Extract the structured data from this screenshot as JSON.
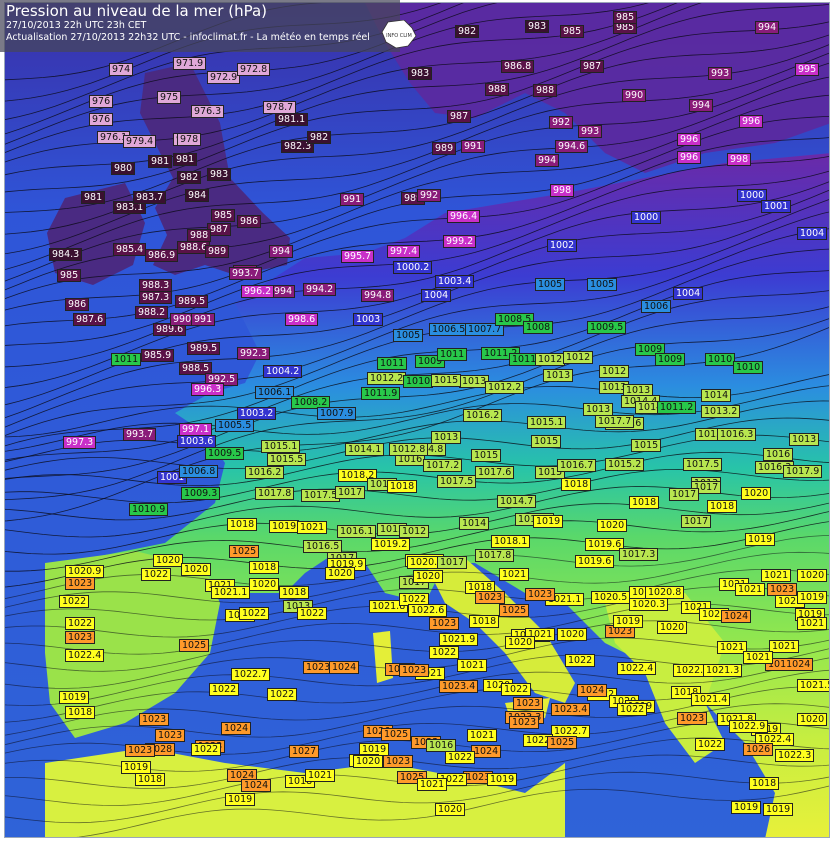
{
  "header": {
    "title": "Pression au niveau de la mer (hPa)",
    "line1": "27/10/2013  22h UTC  23h CET",
    "line2": "Actualisation 27/10/2013 22h32 UTC - infoclimat.fr - La météo en temps réel"
  },
  "logo_text": "INFO CLIM",
  "colors": {
    "water": "#2f63d8",
    "isobar": "#0a0a14",
    "p980": "#3a1030",
    "p985": "#5a1248",
    "p990": "#8a1c7a",
    "p995": "#c92fc9",
    "p1000": "#3434d0",
    "p1005": "#2a8ee0",
    "p1010": "#28c84a",
    "p1015": "#b8e650",
    "p1020": "#ffff1e",
    "p1025": "#ff9a2a",
    "low_pale": "#e0a8d8"
  },
  "stations": [
    {
      "t": "994",
      "v": 994
    },
    {
      "t": "995",
      "v": 995
    },
    {
      "t": "993",
      "v": 993
    },
    {
      "t": "990",
      "v": 990
    },
    {
      "t": "994",
      "v": 994
    },
    {
      "t": "996",
      "v": 996
    },
    {
      "t": "996",
      "v": 996
    },
    {
      "t": "996",
      "v": 996
    },
    {
      "t": "998",
      "v": 998
    },
    {
      "t": "1000",
      "v": 1000
    },
    {
      "t": "1001",
      "v": 1001
    },
    {
      "t": "1004",
      "v": 1004
    },
    {
      "t": "983",
      "v": 983
    },
    {
      "t": "985",
      "v": 985
    },
    {
      "t": "985",
      "v": 985
    },
    {
      "t": "982",
      "v": 982
    },
    {
      "t": "985",
      "v": 985
    },
    {
      "t": "986.8",
      "v": 986.8
    },
    {
      "t": "987",
      "v": 987
    },
    {
      "t": "983",
      "v": 983
    },
    {
      "t": "988",
      "v": 988
    },
    {
      "t": "988",
      "v": 988
    },
    {
      "t": "987",
      "v": 987
    },
    {
      "t": "989",
      "v": 989
    },
    {
      "t": "991",
      "v": 991
    },
    {
      "t": "992",
      "v": 992
    },
    {
      "t": "993",
      "v": 993
    },
    {
      "t": "994.6",
      "v": 994.6
    },
    {
      "t": "994",
      "v": 994
    },
    {
      "t": "998",
      "v": 998
    },
    {
      "t": "989",
      "v": 989
    },
    {
      "t": "991",
      "v": 991
    },
    {
      "t": "992",
      "v": 992
    },
    {
      "t": "996.4",
      "v": 996.4
    },
    {
      "t": "999.2",
      "v": 999.2
    },
    {
      "t": "1002",
      "v": 1002
    },
    {
      "t": "1000",
      "v": 1000
    },
    {
      "t": "1003.4",
      "v": 1003.4
    },
    {
      "t": "1005",
      "v": 1005
    },
    {
      "t": "1005",
      "v": 1005
    },
    {
      "t": "1006",
      "v": 1006
    },
    {
      "t": "1004",
      "v": 1004
    },
    {
      "t": "974",
      "v": 974
    },
    {
      "t": "971.9",
      "v": 971.9
    },
    {
      "t": "972.9",
      "v": 972.9
    },
    {
      "t": "972.8",
      "v": 972.8
    },
    {
      "t": "976",
      "v": 976
    },
    {
      "t": "975",
      "v": 975
    },
    {
      "t": "976.3",
      "v": 976.3
    },
    {
      "t": "978.7",
      "v": 978.7
    },
    {
      "t": "981.1",
      "v": 981.1
    },
    {
      "t": "976",
      "v": 976
    },
    {
      "t": "976.1",
      "v": 976.1
    },
    {
      "t": "978",
      "v": 978
    },
    {
      "t": "979.4",
      "v": 979.4
    },
    {
      "t": "978",
      "v": 978
    },
    {
      "t": "982.3",
      "v": 982.3
    },
    {
      "t": "982",
      "v": 982
    },
    {
      "t": "980",
      "v": 980
    },
    {
      "t": "981",
      "v": 981
    },
    {
      "t": "981",
      "v": 981
    },
    {
      "t": "982",
      "v": 982
    },
    {
      "t": "983",
      "v": 983
    },
    {
      "t": "981",
      "v": 981
    },
    {
      "t": "983.1",
      "v": 983.1
    },
    {
      "t": "983.7",
      "v": 983.7
    },
    {
      "t": "984",
      "v": 984
    },
    {
      "t": "985",
      "v": 985
    },
    {
      "t": "986",
      "v": 986
    },
    {
      "t": "987",
      "v": 987
    },
    {
      "t": "988",
      "v": 988
    },
    {
      "t": "988.6",
      "v": 988.6
    },
    {
      "t": "989",
      "v": 989
    },
    {
      "t": "984.3",
      "v": 984.3
    },
    {
      "t": "985.4",
      "v": 985.4
    },
    {
      "t": "986.9",
      "v": 986.9
    },
    {
      "t": "985",
      "v": 985
    },
    {
      "t": "988.3",
      "v": 988.3
    },
    {
      "t": "987.3",
      "v": 987.3
    },
    {
      "t": "986",
      "v": 986
    },
    {
      "t": "987.6",
      "v": 987.6
    },
    {
      "t": "988.2",
      "v": 988.2
    },
    {
      "t": "989.6",
      "v": 989.6
    },
    {
      "t": "990",
      "v": 990
    },
    {
      "t": "991",
      "v": 991
    },
    {
      "t": "989.5",
      "v": 989.5
    },
    {
      "t": "991",
      "v": 991
    },
    {
      "t": "994",
      "v": 994
    },
    {
      "t": "993.7",
      "v": 993.7
    },
    {
      "t": "994",
      "v": 994
    },
    {
      "t": "994.2",
      "v": 994.2
    },
    {
      "t": "995.7",
      "v": 995.7
    },
    {
      "t": "997.4",
      "v": 997.4
    },
    {
      "t": "994.8",
      "v": 994.8
    },
    {
      "t": "996.2",
      "v": 996.2
    },
    {
      "t": "998.6",
      "v": 998.6
    },
    {
      "t": "1000.2",
      "v": 1000.2
    },
    {
      "t": "1003",
      "v": 1003
    },
    {
      "t": "1004",
      "v": 1004
    },
    {
      "t": "1005",
      "v": 1005
    },
    {
      "t": "1006.5",
      "v": 1006.5
    },
    {
      "t": "1007.7",
      "v": 1007.7
    },
    {
      "t": "1008.5",
      "v": 1008.5
    },
    {
      "t": "1008",
      "v": 1008
    },
    {
      "t": "1009.5",
      "v": 1009.5
    },
    {
      "t": "1009",
      "v": 1009
    },
    {
      "t": "1009",
      "v": 1009
    },
    {
      "t": "1010",
      "v": 1010
    },
    {
      "t": "1010",
      "v": 1010
    },
    {
      "t": "1011",
      "v": 1011
    },
    {
      "t": "985.9",
      "v": 985.9
    },
    {
      "t": "989.5",
      "v": 989.5
    },
    {
      "t": "992.3",
      "v": 992.3
    },
    {
      "t": "988.5",
      "v": 988.5
    },
    {
      "t": "992.5",
      "v": 992.5
    },
    {
      "t": "996.3",
      "v": 996.3
    },
    {
      "t": "997.3",
      "v": 997.3
    },
    {
      "t": "993.7",
      "v": 993.7
    },
    {
      "t": "997.1",
      "v": 997.1
    },
    {
      "t": "1003.6",
      "v": 1003.6
    },
    {
      "t": "1003.2",
      "v": 1003.2
    },
    {
      "t": "1005.5",
      "v": 1005.5
    },
    {
      "t": "1006.1",
      "v": 1006.1
    },
    {
      "t": "1004.2",
      "v": 1004.2
    },
    {
      "t": "1001",
      "v": 1001
    },
    {
      "t": "1006.8",
      "v": 1006.8
    },
    {
      "t": "1009.3",
      "v": 1009.3
    },
    {
      "t": "1010.9",
      "v": 1010.9
    },
    {
      "t": "1009.5",
      "v": 1009.5
    },
    {
      "t": "1008.2",
      "v": 1008.2
    },
    {
      "t": "1007.9",
      "v": 1007.9
    },
    {
      "t": "1011.9",
      "v": 1011.9
    },
    {
      "t": "1012.2",
      "v": 1012.2
    },
    {
      "t": "1010",
      "v": 1010
    },
    {
      "t": "1011",
      "v": 1011
    },
    {
      "t": "1009",
      "v": 1009
    },
    {
      "t": "1011",
      "v": 1011
    },
    {
      "t": "1011.2",
      "v": 1011.2
    },
    {
      "t": "1011",
      "v": 1011
    },
    {
      "t": "1012",
      "v": 1012
    },
    {
      "t": "1012",
      "v": 1012
    },
    {
      "t": "1012",
      "v": 1012
    },
    {
      "t": "1013",
      "v": 1013
    },
    {
      "t": "1013",
      "v": 1013
    },
    {
      "t": "1015",
      "v": 1015
    },
    {
      "t": "1012.2",
      "v": 1012.2
    },
    {
      "t": "1013",
      "v": 1013
    },
    {
      "t": "1013",
      "v": 1013
    },
    {
      "t": "1014.4",
      "v": 1014.4
    },
    {
      "t": "1014",
      "v": 1014
    },
    {
      "t": "1013.2",
      "v": 1013.2
    },
    {
      "t": "1013",
      "v": 1013
    },
    {
      "t": "1014.6",
      "v": 1014.6
    },
    {
      "t": "1014.7",
      "v": 1014.7
    },
    {
      "t": "1011.2",
      "v": 1011.2
    },
    {
      "t": "1015.1",
      "v": 1015.1
    },
    {
      "t": "1016.2",
      "v": 1016.2
    },
    {
      "t": "1015.1",
      "v": 1015.1
    },
    {
      "t": "1017.7",
      "v": 1017.7
    },
    {
      "t": "1015",
      "v": 1015
    },
    {
      "t": "1015",
      "v": 1015
    },
    {
      "t": "1015.5",
      "v": 1015.5
    },
    {
      "t": "1013",
      "v": 1013
    },
    {
      "t": "1014.1",
      "v": 1014.1
    },
    {
      "t": "1013",
      "v": 1013
    },
    {
      "t": "1014.8",
      "v": 1014.8
    },
    {
      "t": "1015.5",
      "v": 1015.5
    },
    {
      "t": "1016",
      "v": 1016
    },
    {
      "t": "1017.2",
      "v": 1017.2
    },
    {
      "t": "1015",
      "v": 1015
    },
    {
      "t": "1012.8",
      "v": 1012.8
    },
    {
      "t": "1016.3",
      "v": 1016.3
    },
    {
      "t": "1016.2",
      "v": 1016.2
    },
    {
      "t": "1017.8",
      "v": 1017.8
    },
    {
      "t": "1017.5",
      "v": 1017.5
    },
    {
      "t": "1017",
      "v": 1017
    },
    {
      "t": "1018.2",
      "v": 1018.2
    },
    {
      "t": "1015",
      "v": 1015
    },
    {
      "t": "1018",
      "v": 1018
    },
    {
      "t": "1017.5",
      "v": 1017.5
    },
    {
      "t": "1017.6",
      "v": 1017.6
    },
    {
      "t": "1015",
      "v": 1015
    },
    {
      "t": "1016.7",
      "v": 1016.7
    },
    {
      "t": "1018",
      "v": 1018
    },
    {
      "t": "1015.2",
      "v": 1015.2
    },
    {
      "t": "1013",
      "v": 1013
    },
    {
      "t": "1016.3",
      "v": 1016.3
    },
    {
      "t": "1016",
      "v": 1016
    },
    {
      "t": "1017.5",
      "v": 1017.5
    },
    {
      "t": "1017.9",
      "v": 1017.9
    },
    {
      "t": "1017",
      "v": 1017
    },
    {
      "t": "1017",
      "v": 1017
    },
    {
      "t": "1018",
      "v": 1018
    },
    {
      "t": "1020",
      "v": 1020
    },
    {
      "t": "1018",
      "v": 1018
    },
    {
      "t": "1017",
      "v": 1017
    },
    {
      "t": "1014.7",
      "v": 1014.7
    },
    {
      "t": "1016.7",
      "v": 1016.7
    },
    {
      "t": "1019",
      "v": 1019
    },
    {
      "t": "1020",
      "v": 1020
    },
    {
      "t": "1019",
      "v": 1019
    },
    {
      "t": "1019.6",
      "v": 1019.6
    },
    {
      "t": "1018",
      "v": 1018
    },
    {
      "t": "1019",
      "v": 1019
    },
    {
      "t": "1021",
      "v": 1021
    },
    {
      "t": "1016.1",
      "v": 1016.1
    },
    {
      "t": "1012",
      "v": 1012
    },
    {
      "t": "1012",
      "v": 1012
    },
    {
      "t": "1014",
      "v": 1014
    },
    {
      "t": "1016.5",
      "v": 1016.5
    },
    {
      "t": "1017",
      "v": 1017
    },
    {
      "t": "1019.2",
      "v": 1019.2
    },
    {
      "t": "1019.6",
      "v": 1019.6
    },
    {
      "t": "1018.1",
      "v": 1018.1
    },
    {
      "t": "1025",
      "v": 1025
    },
    {
      "t": "1020",
      "v": 1020
    },
    {
      "t": "1022",
      "v": 1022
    },
    {
      "t": "1020",
      "v": 1020
    },
    {
      "t": "1013",
      "v": 1013
    },
    {
      "t": "1018",
      "v": 1018
    },
    {
      "t": "1019.9",
      "v": 1019.9
    },
    {
      "t": "1020",
      "v": 1020
    },
    {
      "t": "1020.8",
      "v": 1020.8
    },
    {
      "t": "1017",
      "v": 1017
    },
    {
      "t": "1017.8",
      "v": 1017.8
    },
    {
      "t": "1019.6",
      "v": 1019.6
    },
    {
      "t": "1017.3",
      "v": 1017.3
    },
    {
      "t": "1020.9",
      "v": 1020.9
    },
    {
      "t": "1023",
      "v": 1023
    },
    {
      "t": "1022",
      "v": 1022
    },
    {
      "t": "1021",
      "v": 1021
    },
    {
      "t": "1021.1",
      "v": 1021.1
    },
    {
      "t": "1020",
      "v": 1020
    },
    {
      "t": "1018",
      "v": 1018
    },
    {
      "t": "1017",
      "v": 1017
    },
    {
      "t": "1020",
      "v": 1020
    },
    {
      "t": "1018",
      "v": 1018
    },
    {
      "t": "1021",
      "v": 1021
    },
    {
      "t": "1021.1",
      "v": 1021.1
    },
    {
      "t": "1020.5",
      "v": 1020.5
    },
    {
      "t": "1020.3",
      "v": 1020.3
    },
    {
      "t": "1019.6",
      "v": 1019.6
    },
    {
      "t": "1020.8",
      "v": 1020.8
    },
    {
      "t": "1021",
      "v": 1021
    },
    {
      "t": "1021",
      "v": 1021
    },
    {
      "t": "1023",
      "v": 1023
    },
    {
      "t": "1020",
      "v": 1020
    },
    {
      "t": "1021",
      "v": 1021
    },
    {
      "t": "1021",
      "v": 1021
    },
    {
      "t": "1021",
      "v": 1021
    },
    {
      "t": "1021",
      "v": 1021
    },
    {
      "t": "1022",
      "v": 1022
    },
    {
      "t": "1021.8",
      "v": 1021.8
    },
    {
      "t": "1022",
      "v": 1022
    },
    {
      "t": "1022.6",
      "v": 1022.6
    },
    {
      "t": "1023",
      "v": 1023
    },
    {
      "t": "1025",
      "v": 1025
    },
    {
      "t": "1023",
      "v": 1023
    },
    {
      "t": "1020",
      "v": 1020
    },
    {
      "t": "1024",
      "v": 1024
    },
    {
      "t": "1021",
      "v": 1021
    },
    {
      "t": "1019",
      "v": 1019
    },
    {
      "t": "1021",
      "v": 1021
    },
    {
      "t": "1019",
      "v": 1019
    },
    {
      "t": "1023",
      "v": 1023
    },
    {
      "t": "1022",
      "v": 1022
    },
    {
      "t": "1022",
      "v": 1022
    },
    {
      "t": "1023",
      "v": 1023
    },
    {
      "t": "1021.9",
      "v": 1021.9
    },
    {
      "t": "1020.5",
      "v": 1020.5
    },
    {
      "t": "1021",
      "v": 1021
    },
    {
      "t": "1020",
      "v": 1020
    },
    {
      "t": "1019",
      "v": 1019
    },
    {
      "t": "1018",
      "v": 1018
    },
    {
      "t": "1020",
      "v": 1020
    },
    {
      "t": "1022",
      "v": 1022
    },
    {
      "t": "1021",
      "v": 1021
    },
    {
      "t": "1011024",
      "v": 1024
    },
    {
      "t": "1021.5",
      "v": 1021.5
    },
    {
      "t": "1022",
      "v": 1022
    },
    {
      "t": "1022.4",
      "v": 1022.4
    },
    {
      "t": "1022.7",
      "v": 1022.7
    },
    {
      "t": "1021.3",
      "v": 1021.3
    },
    {
      "t": "1021",
      "v": 1021
    },
    {
      "t": "1022",
      "v": 1022
    },
    {
      "t": "1022",
      "v": 1022
    },
    {
      "t": "1023",
      "v": 1023
    },
    {
      "t": "1025",
      "v": 1025
    },
    {
      "t": "1022.4",
      "v": 1022.4
    },
    {
      "t": "1022.7",
      "v": 1022.7
    },
    {
      "t": "1023.6",
      "v": 1023.6
    },
    {
      "t": "1024",
      "v": 1024
    },
    {
      "t": "1023",
      "v": 1023
    },
    {
      "t": "1021",
      "v": 1021
    },
    {
      "t": "1021",
      "v": 1021
    },
    {
      "t": "1020",
      "v": 1020
    },
    {
      "t": "1019",
      "v": 1019
    },
    {
      "t": "1018",
      "v": 1018
    },
    {
      "t": "1022",
      "v": 1022
    },
    {
      "t": "1022",
      "v": 1022
    },
    {
      "t": "1023",
      "v": 1023
    },
    {
      "t": "1023.4",
      "v": 1023.4
    },
    {
      "t": "1022",
      "v": 1022
    },
    {
      "t": "1023",
      "v": 1023
    },
    {
      "t": "1024",
      "v": 1024
    },
    {
      "t": "1020",
      "v": 1020
    },
    {
      "t": "1019",
      "v": 1019
    },
    {
      "t": "1018",
      "v": 1018
    },
    {
      "t": "1021.4",
      "v": 1021.4
    },
    {
      "t": "1023.4",
      "v": 1023.4
    },
    {
      "t": "1022.7",
      "v": 1022.7
    },
    {
      "t": "1023.3",
      "v": 1023.3
    },
    {
      "t": "1023",
      "v": 1023
    },
    {
      "t": "1022",
      "v": 1022
    },
    {
      "t": "1023",
      "v": 1023
    },
    {
      "t": "1021.8",
      "v": 1021.8
    },
    {
      "t": "1019",
      "v": 1019
    },
    {
      "t": "1020",
      "v": 1020
    },
    {
      "t": "1022.9",
      "v": 1022.9
    },
    {
      "t": "1022.4",
      "v": 1022.4
    },
    {
      "t": "1022.3",
      "v": 1022.3
    },
    {
      "t": "1023",
      "v": 1023
    },
    {
      "t": "1023",
      "v": 1023
    },
    {
      "t": "1024",
      "v": 1024
    },
    {
      "t": "1023",
      "v": 1023
    },
    {
      "t": "1028",
      "v": 1028
    },
    {
      "t": "1026",
      "v": 1026
    },
    {
      "t": "1025",
      "v": 1025
    },
    {
      "t": "1027",
      "v": 1027
    },
    {
      "t": "1023",
      "v": 1023
    },
    {
      "t": "1019",
      "v": 1019
    },
    {
      "t": "1021",
      "v": 1021
    },
    {
      "t": "1022",
      "v": 1022
    },
    {
      "t": "1024",
      "v": 1024
    },
    {
      "t": "1025",
      "v": 1025
    },
    {
      "t": "1022",
      "v": 1022
    },
    {
      "t": "1026",
      "v": 1026
    },
    {
      "t": "1023",
      "v": 1023
    },
    {
      "t": "1019",
      "v": 1019
    },
    {
      "t": "1018",
      "v": 1018
    },
    {
      "t": "1022",
      "v": 1022
    },
    {
      "t": "1024",
      "v": 1024
    },
    {
      "t": "1024",
      "v": 1024
    },
    {
      "t": "1018",
      "v": 1018
    },
    {
      "t": "1021",
      "v": 1021
    },
    {
      "t": "1022",
      "v": 1022
    },
    {
      "t": "1023",
      "v": 1023
    },
    {
      "t": "1016",
      "v": 1016
    },
    {
      "t": "1025",
      "v": 1025
    },
    {
      "t": "1022",
      "v": 1022
    },
    {
      "t": "1023",
      "v": 1023
    },
    {
      "t": "1022",
      "v": 1022
    },
    {
      "t": "1019",
      "v": 1019
    },
    {
      "t": "1020",
      "v": 1020
    },
    {
      "t": "1021",
      "v": 1021
    },
    {
      "t": "1020",
      "v": 1020
    },
    {
      "t": "1019",
      "v": 1019
    },
    {
      "t": "1019",
      "v": 1019
    },
    {
      "t": "1018",
      "v": 1018
    },
    {
      "t": "1019",
      "v": 1019
    }
  ]
}
